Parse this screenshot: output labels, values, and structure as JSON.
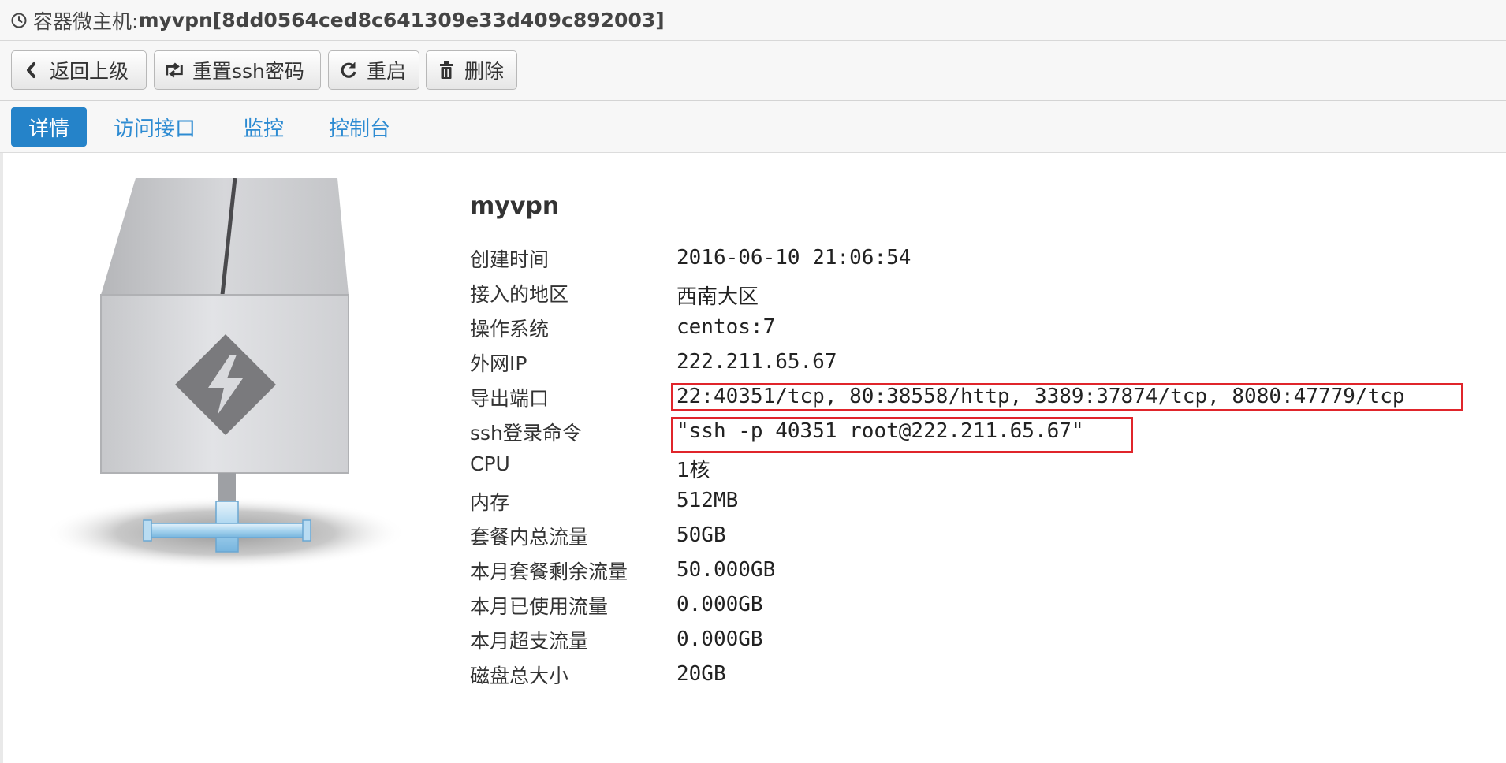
{
  "window": {
    "title_prefix": "容器微主机:",
    "title_name": "myvpn[8dd0564ced8c641309e33d409c892003]"
  },
  "toolbar": {
    "back_label": "返回上级",
    "reset_ssh_label": "重置ssh密码",
    "restart_label": "重启",
    "delete_label": "删除"
  },
  "tabs": [
    {
      "label": "详情",
      "active": true
    },
    {
      "label": "访问接口",
      "active": false
    },
    {
      "label": "监控",
      "active": false
    },
    {
      "label": "控制台",
      "active": false
    }
  ],
  "detail": {
    "name": "myvpn",
    "rows": [
      {
        "key": "创建时间",
        "value": "2016-06-10 21:06:54"
      },
      {
        "key": "接入的地区",
        "value": "西南大区"
      },
      {
        "key": "操作系统",
        "value": "centos:7"
      },
      {
        "key": "外网IP",
        "value": "222.211.65.67"
      },
      {
        "key": "导出端口",
        "value": "22:40351/tcp, 80:38558/http, 3389:37874/tcp, 8080:47779/tcp"
      },
      {
        "key": "ssh登录命令",
        "value": "\"ssh -p 40351 root@222.211.65.67\""
      },
      {
        "key": "CPU",
        "value": "1核"
      },
      {
        "key": "内存",
        "value": "512MB"
      },
      {
        "key": "套餐内总流量",
        "value": "50GB"
      },
      {
        "key": "本月套餐剩余流量",
        "value": "50.000GB"
      },
      {
        "key": "本月已使用流量",
        "value": "0.000GB"
      },
      {
        "key": "本月超支流量",
        "value": "0.000GB"
      },
      {
        "key": "磁盘总大小",
        "value": "20GB"
      }
    ]
  },
  "icons": {
    "title": "clock-icon",
    "back": "chevron-left-icon",
    "reset_ssh": "retweet-icon",
    "restart": "refresh-icon",
    "delete": "trash-icon",
    "illustration": "server-icon"
  },
  "colors": {
    "accent": "#2583c9",
    "highlight": "#e0252b"
  }
}
